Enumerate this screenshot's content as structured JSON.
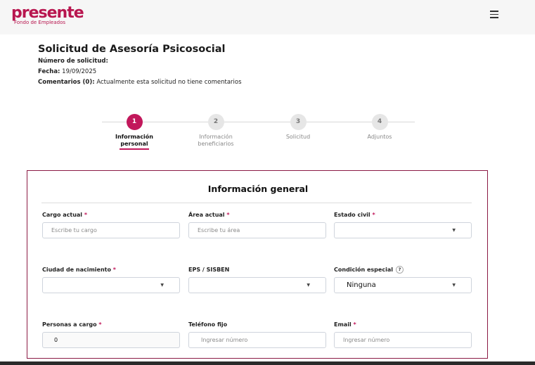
{
  "header": {
    "logo_word": "presente",
    "logo_subtitle": "Fondo de Empleados"
  },
  "request": {
    "title": "Solicitud de Asesoría Psicosocial",
    "number_label": "Número de solicitud:",
    "number_value": "",
    "date_label": "Fecha:",
    "date_value": "19/09/2025",
    "comments_label": "Comentarios (0):",
    "comments_value": "Actualmente esta solicitud no tiene comentarios"
  },
  "stepper": {
    "steps": [
      {
        "number": "1",
        "label_line1": "Información",
        "label_line2": "personal",
        "active": true
      },
      {
        "number": "2",
        "label_line1": "Información",
        "label_line2": "beneficiarios",
        "active": false
      },
      {
        "number": "3",
        "label_line1": "Solicitud",
        "label_line2": "",
        "active": false
      },
      {
        "number": "4",
        "label_line1": "Adjuntos",
        "label_line2": "",
        "active": false
      }
    ]
  },
  "form": {
    "title": "Información general",
    "required_mark": "*",
    "fields": {
      "cargo": {
        "label": "Cargo actual",
        "placeholder": "Escribe tu cargo"
      },
      "area": {
        "label": "Área actual",
        "placeholder": "Escribe tu área"
      },
      "estado_civil": {
        "label": "Estado civil",
        "value": ""
      },
      "ciudad": {
        "label": "Ciudad de nacimiento",
        "value": ""
      },
      "eps": {
        "label": "EPS / SISBEN",
        "value": ""
      },
      "condicion": {
        "label": "Condición especial",
        "help": "?",
        "value": "Ninguna"
      },
      "personas": {
        "label": "Personas a cargo",
        "value": "0"
      },
      "telefono": {
        "label": "Teléfono fijo",
        "placeholder": "Ingresar número"
      },
      "email": {
        "label": "Email",
        "placeholder": "Ingresar número"
      }
    }
  },
  "icons": {
    "caret": "▼",
    "menu": "hamburger-menu-icon"
  },
  "colors": {
    "brand": "#c2185b",
    "card_border": "#8b1a44"
  }
}
